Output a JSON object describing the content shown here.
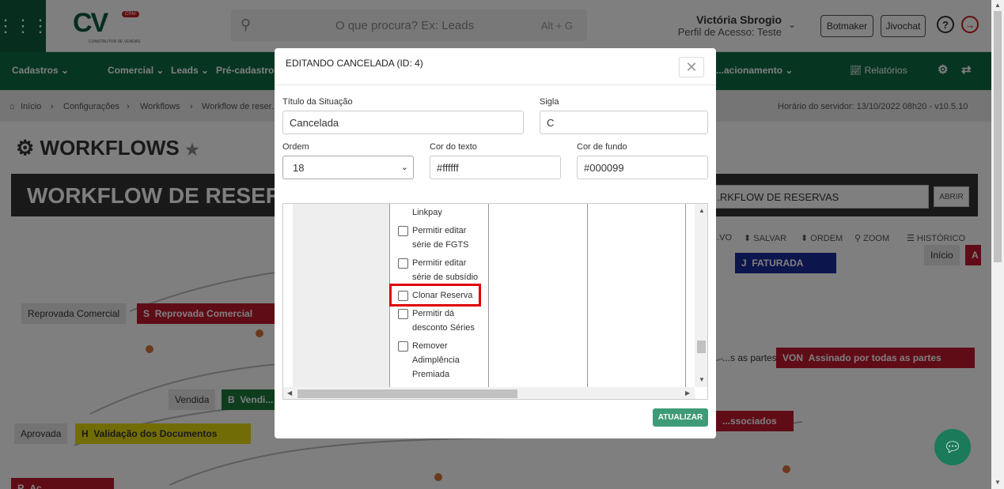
{
  "header": {
    "search_placeholder": "O que procura? Ex: Leads",
    "search_shortcut": "Alt + G",
    "user_name": "Victória Sbrogio",
    "user_profile": "Perfil de Acesso: Teste",
    "botmaker": "Botmaker",
    "jivochat": "Jivochat",
    "logo_text": "CV",
    "logo_badge": "CRM",
    "logo_sub": "CONSTRUTOR DE VENDAS"
  },
  "nav": {
    "items": [
      "Cadastros",
      "Comercial",
      "Leads",
      "Pré-cadastros",
      "...acionamento",
      "Relatórios"
    ]
  },
  "breadcrumb": {
    "items": [
      "Início",
      "Configurações",
      "Workflows",
      "Workflow de reser..."
    ],
    "server_time": "Horário do servidor: 13/10/2022 08h20 - v10.5.10"
  },
  "page": {
    "title": "WORKFLOWS",
    "workflow_banner": "WORKFLOW DE RESER...",
    "workflow_select": "...RKFLOW DE RESERVAS",
    "abrir": "ABRIR",
    "tools": [
      "...VO",
      "SALVAR",
      "ORDEM",
      "ZOOM",
      "HISTÓRICO"
    ]
  },
  "background_nodes": [
    {
      "label": "Reprovada Comercial",
      "sigla": "S",
      "name": "Reprovada Comercial"
    },
    {
      "label": "Vendida",
      "sigla": "B",
      "name": "Vendi..."
    },
    {
      "label": "Aprovada",
      "sigla": "H",
      "name": "Validação dos Documentos"
    },
    {
      "label": "Início",
      "sigla": "A",
      "name": ""
    },
    {
      "label": "",
      "sigla": "J",
      "name": "FATURADA"
    },
    {
      "label": "...s as partes",
      "sigla": "VON",
      "name": "Assinado por todas as partes"
    },
    {
      "label": "",
      "sigla": "",
      "name": "...ssociados"
    },
    {
      "label": "",
      "sigla": "R",
      "name": "Aç..."
    }
  ],
  "modal": {
    "title": "EDITANDO CANCELADA (ID: 4)",
    "close": "✕",
    "fields": {
      "titulo_label": "Título da Situação",
      "titulo_value": "Cancelada",
      "sigla_label": "Sigla",
      "sigla_value": "C",
      "ordem_label": "Ordem",
      "ordem_value": "18",
      "cor_texto_label": "Cor do texto",
      "cor_texto_value": "#ffffff",
      "cor_fundo_label": "Cor de fundo",
      "cor_fundo_value": "#000099"
    },
    "permissions": [
      {
        "label": "Linkpay",
        "checked": false,
        "partial": true
      },
      {
        "label": "Permitir editar série de FGTS",
        "checked": false
      },
      {
        "label": "Permitir editar série de subsídio",
        "checked": false
      },
      {
        "label": "Clonar Reserva",
        "checked": false,
        "highlighted": true
      },
      {
        "label": "Permitir dá desconto Séries",
        "checked": false
      },
      {
        "label": "Remover Adimplência Premiada",
        "checked": false
      }
    ],
    "submit": "ATUALIZAR"
  },
  "colors": {
    "brand_green": "#0c6b45",
    "dark_green": "#0c5a3c",
    "button_green": "#3e9b77",
    "highlight_red": "#e00000",
    "node_red": "#c0182f",
    "node_yellow": "#e5d90f",
    "node_blue": "#1a2a9a"
  }
}
